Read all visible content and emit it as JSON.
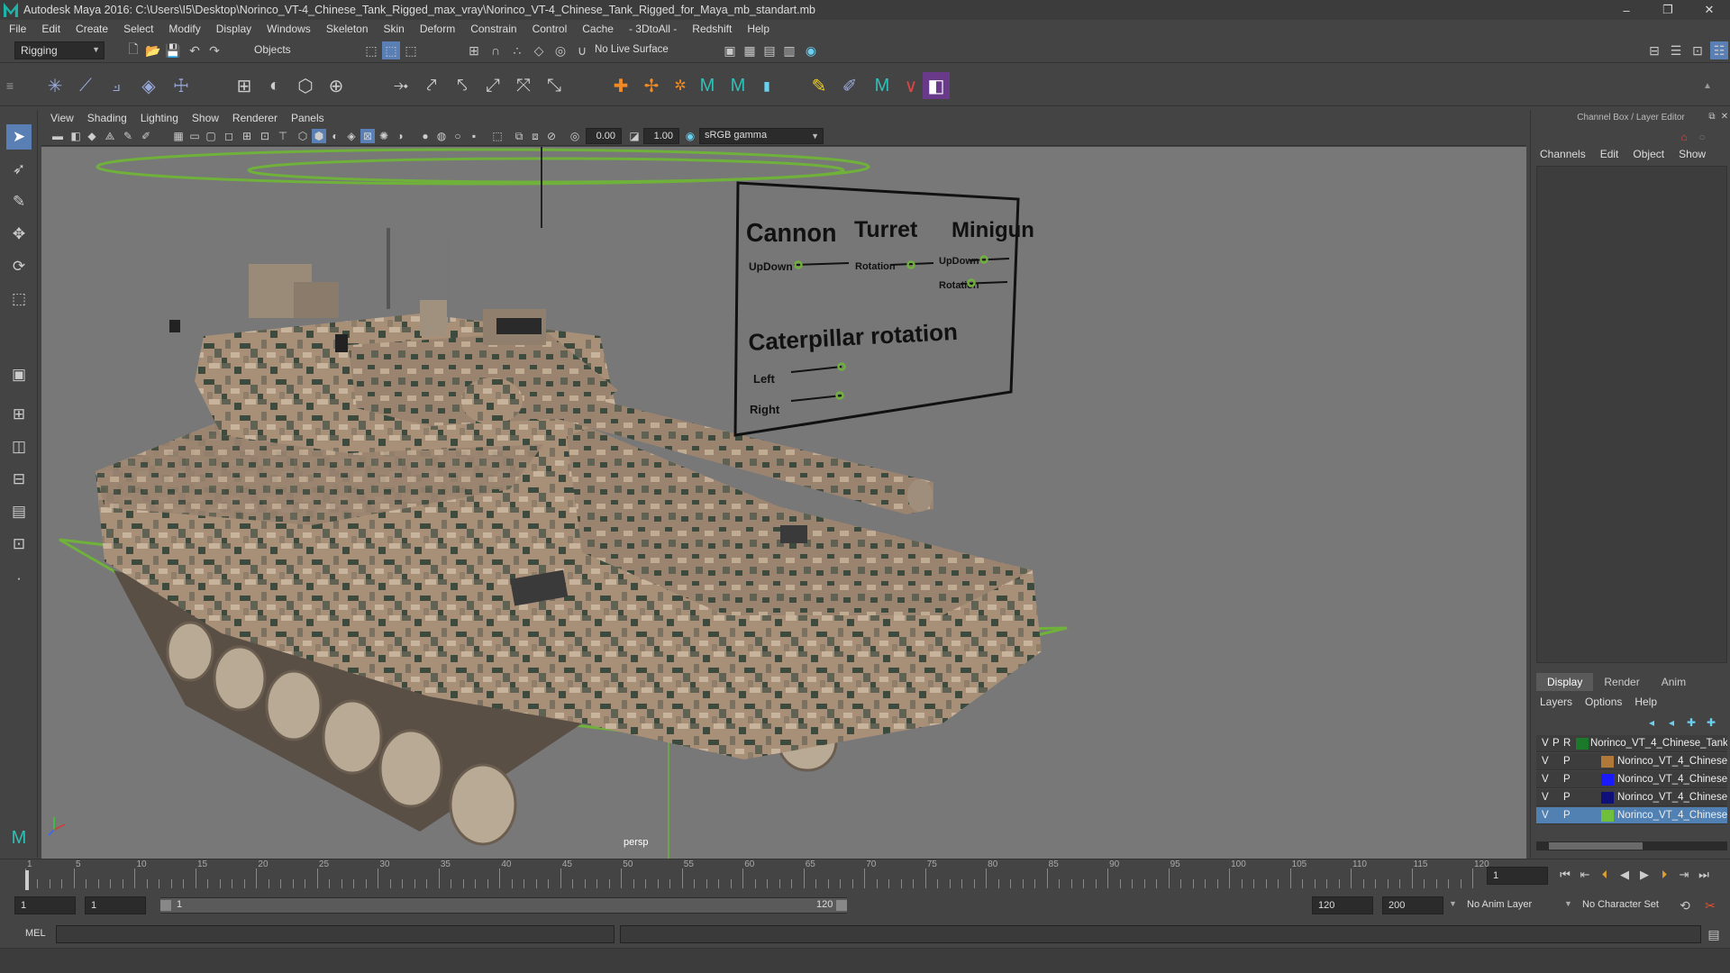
{
  "window": {
    "title": "Autodesk Maya 2016: C:\\Users\\I5\\Desktop\\Norinco_VT-4_Chinese_Tank_Rigged_max_vray\\Norinco_VT-4_Chinese_Tank_Rigged_for_Maya_mb_standart.mb",
    "minimize": "–",
    "maximize": "❐",
    "close": "✕"
  },
  "menubar": [
    "File",
    "Edit",
    "Create",
    "Select",
    "Modify",
    "Display",
    "Windows",
    "Skeleton",
    "Skin",
    "Deform",
    "Constrain",
    "Control",
    "Cache",
    "- 3DtoAll -",
    "Redshift",
    "Help"
  ],
  "statusline": {
    "menuset": "Rigging",
    "selection_mode": "Objects",
    "live_surface": "No Live Surface"
  },
  "panel": {
    "menus": [
      "View",
      "Shading",
      "Lighting",
      "Show",
      "Renderer",
      "Panels"
    ],
    "exposure": "0.00",
    "gamma": "1.00",
    "color_space": "sRGB gamma",
    "camera_label": "persp"
  },
  "controls_board": {
    "cannon": "Cannon",
    "turret": "Turret",
    "minigun": "Minigun",
    "updown": "UpDown",
    "rotation": "Rotation",
    "minigun_updown": "UpDown",
    "minigun_rotation": "Rotation",
    "caterpillar": "Caterpillar rotation",
    "left": "Left",
    "right": "Right"
  },
  "channel_box": {
    "title": "Channel Box / Layer Editor",
    "menus": [
      "Channels",
      "Edit",
      "Object",
      "Show"
    ]
  },
  "layer_editor": {
    "tabs": [
      "Display",
      "Render",
      "Anim"
    ],
    "menus": [
      "Layers",
      "Options",
      "Help"
    ],
    "layers": [
      {
        "v": "V",
        "p": "P",
        "r": "R",
        "name": "Norinco_VT_4_Chinese_Tank",
        "color": "#1a7a2a",
        "selected": false
      },
      {
        "v": "V",
        "p": "P",
        "r": "",
        "name": "Norinco_VT_4_Chinese",
        "color": "#b0793a",
        "selected": false
      },
      {
        "v": "V",
        "p": "P",
        "r": "",
        "name": "Norinco_VT_4_Chinese",
        "color": "#1a1aff",
        "selected": false
      },
      {
        "v": "V",
        "p": "P",
        "r": "",
        "name": "Norinco_VT_4_Chinese",
        "color": "#10107a",
        "selected": false
      },
      {
        "v": "V",
        "p": "P",
        "r": "",
        "name": "Norinco_VT_4_Chinese",
        "color": "#6fbf3a",
        "selected": true
      }
    ]
  },
  "timeline": {
    "ticks": [
      "1",
      "5",
      "10",
      "15",
      "20",
      "25",
      "30",
      "35",
      "40",
      "45",
      "50",
      "55",
      "60",
      "65",
      "70",
      "75",
      "80",
      "85",
      "90",
      "95",
      "100",
      "105",
      "110",
      "115",
      "120"
    ],
    "current_frame": "1"
  },
  "range": {
    "start": "1",
    "playback_start": "1",
    "slider_start": "1",
    "slider_end": "120",
    "playback_end": "120",
    "end": "200",
    "anim_layer": "No Anim Layer",
    "character_set": "No Character Set"
  },
  "command": {
    "lang": "MEL"
  }
}
